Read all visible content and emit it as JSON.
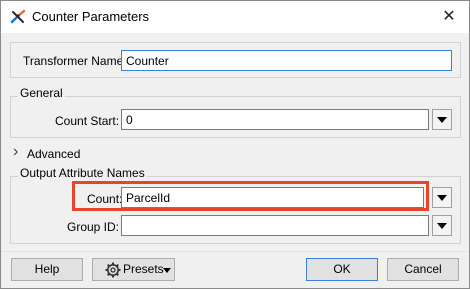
{
  "window": {
    "title": "Counter Parameters",
    "close_glyph": "✕"
  },
  "transformer": {
    "label": "Transformer Name:",
    "value": "Counter"
  },
  "general": {
    "title": "General",
    "count_start_label": "Count Start:",
    "count_start_value": "0"
  },
  "advanced": {
    "title": "Advanced",
    "chevron": "›"
  },
  "output": {
    "title": "Output Attribute Names",
    "count_label": "Count:",
    "count_value": "ParcelId",
    "group_id_label": "Group ID:",
    "group_id_value": ""
  },
  "buttons": {
    "help": "Help",
    "presets": "Presets",
    "ok": "OK",
    "cancel": "Cancel"
  },
  "colors": {
    "highlight": "#e6452c",
    "focus": "#3c7fd7"
  },
  "icons": {
    "title": "fme-transformer-icon",
    "close": "close-icon",
    "chevron": "chevron-right-icon",
    "gear": "gear-icon",
    "dropdown": "chevron-down-icon"
  }
}
